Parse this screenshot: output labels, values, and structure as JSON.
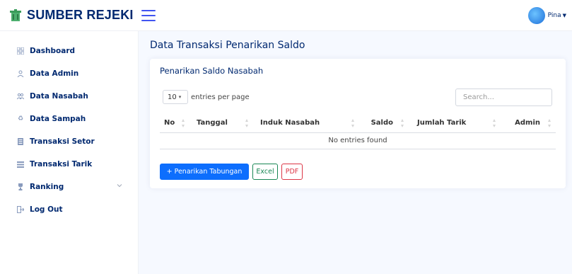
{
  "brand": {
    "name": "SUMBER REJEKI",
    "icon": "recycle-bin-icon"
  },
  "header": {
    "user_name": "Pina",
    "accent": "#4154f1",
    "brand_color": "#012970"
  },
  "sidebar": {
    "items": [
      {
        "label": "Dashboard",
        "icon": "grid-icon"
      },
      {
        "label": "Data Admin",
        "icon": "person-icon"
      },
      {
        "label": "Data Nasabah",
        "icon": "people-icon"
      },
      {
        "label": "Data Sampah",
        "icon": "recycle-icon"
      },
      {
        "label": "Transaksi Setor",
        "icon": "document-icon"
      },
      {
        "label": "Transaksi Tarik",
        "icon": "list-icon"
      },
      {
        "label": "Ranking",
        "icon": "trophy-icon",
        "has_submenu": true
      },
      {
        "label": "Log Out",
        "icon": "logout-icon"
      }
    ]
  },
  "main": {
    "page_title": "Data Transaksi Penarikan Saldo",
    "card_title": "Penarikan Saldo Nasabah",
    "per_page_value": "10",
    "per_page_label": "entries per page",
    "search_placeholder": "Search...",
    "columns": [
      "No",
      "Tanggal",
      "Induk Nasabah",
      "Saldo",
      "Jumlah Tarik",
      "Admin"
    ],
    "empty_text": "No entries found",
    "buttons": {
      "add": "+ Penarikan Tabungan",
      "excel": "Excel",
      "pdf": "PDF"
    },
    "colors": {
      "primary": "#0d6efd",
      "excel": "#198754",
      "pdf": "#dc3545"
    }
  }
}
